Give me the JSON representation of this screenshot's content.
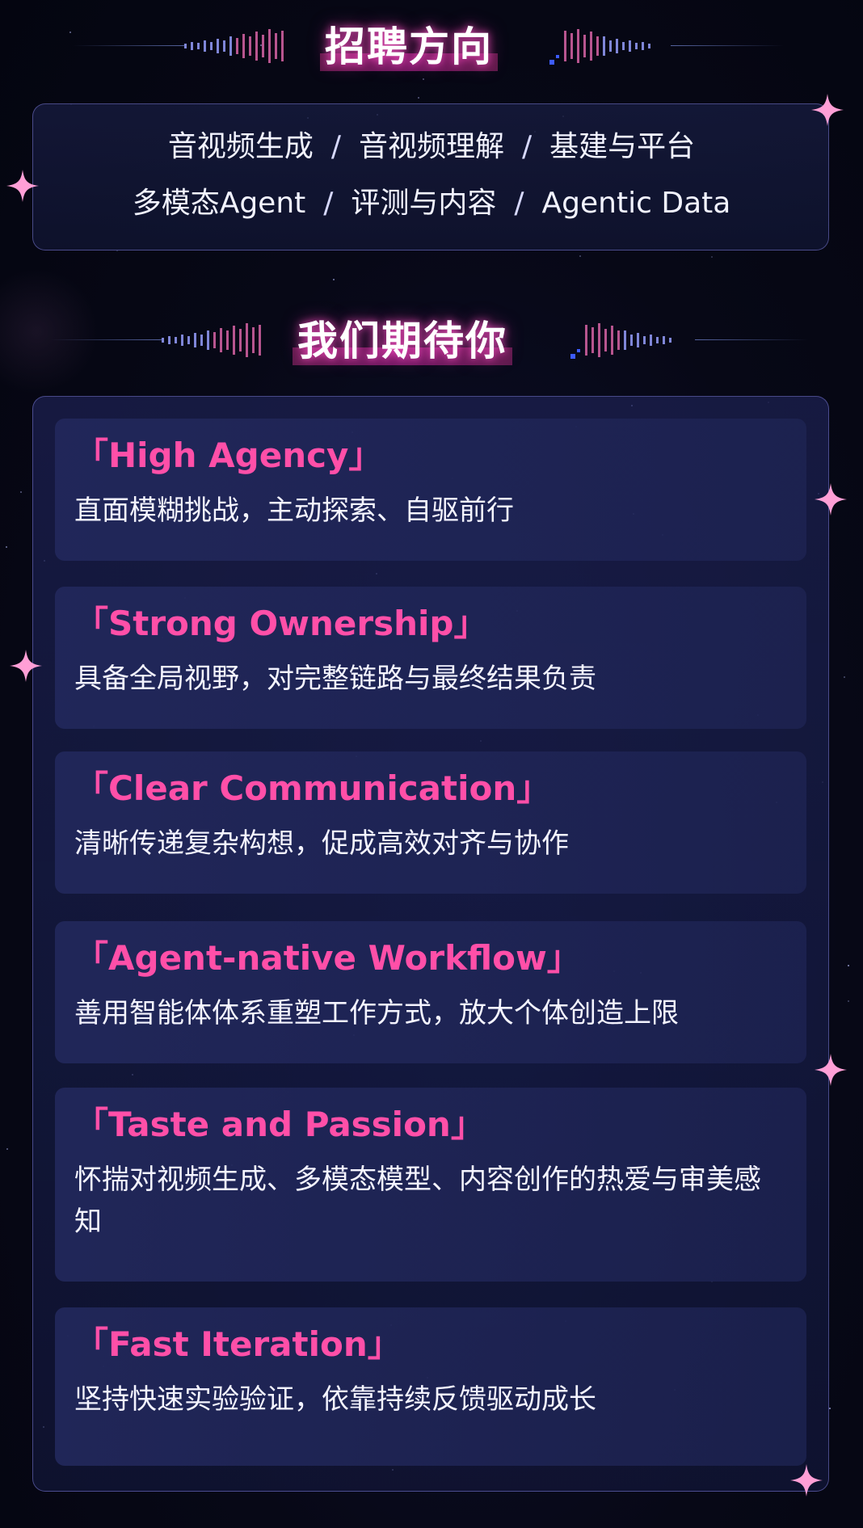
{
  "recruitment_section": {
    "heading": "招聘方向",
    "directions_row1": [
      "音视频生成",
      "音视频理解",
      "基建与平台"
    ],
    "directions_row2": [
      "多模态Agent",
      "评测与内容",
      "Agentic Data"
    ],
    "separator": "/"
  },
  "expectations_section": {
    "heading": "我们期待你",
    "items": [
      {
        "title": "「High Agency」",
        "desc": "直面模糊挑战，主动探索、自驱前行"
      },
      {
        "title": "「Strong Ownership」",
        "desc": "具备全局视野，对完整链路与最终结果负责"
      },
      {
        "title": "「Clear Communication」",
        "desc": "清晰传递复杂构想，促成高效对齐与协作"
      },
      {
        "title": "「Agent-native Workflow」",
        "desc": "善用智能体体系重塑工作方式，放大个体创造上限"
      },
      {
        "title": "「Taste and Passion」",
        "desc": "怀揣对视频生成、多模态模型、内容创作的热爱与审美感知"
      },
      {
        "title": "「Fast Iteration」",
        "desc": "坚持快速实验验证，依靠持续反馈驱动成长"
      }
    ]
  },
  "colors": {
    "accent_pink": "#ff4fa8",
    "background": "#070816",
    "panel_border": "#7878d2"
  },
  "icons": [
    "sparkle-icon",
    "sound-wave-icon"
  ]
}
